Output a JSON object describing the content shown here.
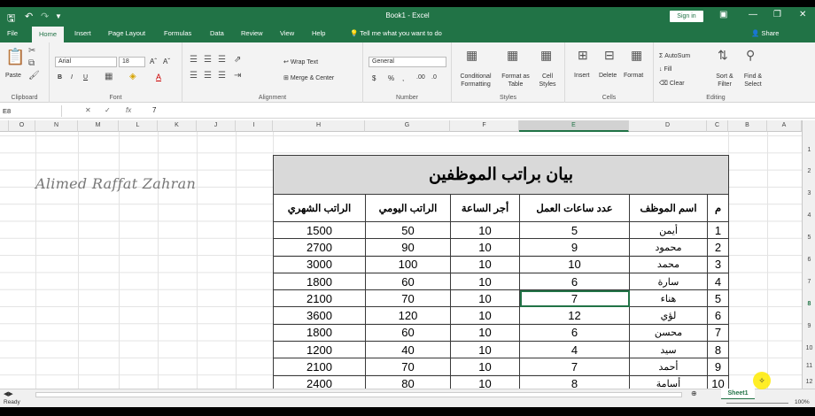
{
  "titlebar": {
    "title": "Book1 - Excel",
    "signin": "Sign in"
  },
  "tabs": [
    "File",
    "Home",
    "Insert",
    "Page Layout",
    "Formulas",
    "Data",
    "Review",
    "View",
    "Help"
  ],
  "active_tab": "Home",
  "tellme": "Tell me what you want to do",
  "share": "Share",
  "ribbon": {
    "font_name": "Arial",
    "font_size": "18",
    "wrap_text": "Wrap Text",
    "merge_center": "Merge & Center",
    "number_format": "General",
    "conditional_formatting": "Conditional Formatting",
    "format_as_table": "Format as Table",
    "cell_styles": "Cell Styles",
    "insert": "Insert",
    "delete": "Delete",
    "format": "Format",
    "autosum": "AutoSum",
    "fill": "Fill",
    "clear": "Clear",
    "sort_filter": "Sort & Filter",
    "find_select": "Find & Select",
    "paste": "Paste",
    "groups": {
      "clipboard": "Clipboard",
      "font": "Font",
      "alignment": "Alignment",
      "number": "Number",
      "styles": "Styles",
      "cells": "Cells",
      "editing": "Editing"
    }
  },
  "formula_bar": {
    "name_box": "E8",
    "value": "7"
  },
  "columns": [
    "O",
    "N",
    "M",
    "L",
    "K",
    "J",
    "I",
    "H",
    "G",
    "F",
    "E",
    "D",
    "C",
    "B",
    "A"
  ],
  "selected_column": "E",
  "row_numbers": [
    "1",
    "2",
    "3",
    "4",
    "5",
    "6",
    "7",
    "8",
    "9",
    "10",
    "11",
    "12"
  ],
  "watermark": "Alimed Raffat Zahran",
  "table": {
    "title": "بيان براتب الموظفين",
    "headers": [
      "م",
      "اسم الموظف",
      "عدد ساعات العمل",
      "أجر الساعة",
      "الراتب اليومي",
      "الراتب الشهري"
    ],
    "rows": [
      [
        "1",
        "أيمن",
        "5",
        "10",
        "50",
        "1500"
      ],
      [
        "2",
        "محمود",
        "9",
        "10",
        "90",
        "2700"
      ],
      [
        "3",
        "محمد",
        "10",
        "10",
        "100",
        "3000"
      ],
      [
        "4",
        "سارة",
        "6",
        "10",
        "60",
        "1800"
      ],
      [
        "5",
        "هناء",
        "7",
        "10",
        "70",
        "2100"
      ],
      [
        "6",
        "لؤي",
        "12",
        "10",
        "120",
        "3600"
      ],
      [
        "7",
        "محسن",
        "6",
        "10",
        "60",
        "1800"
      ],
      [
        "8",
        "سيد",
        "4",
        "10",
        "40",
        "1200"
      ],
      [
        "9",
        "أحمد",
        "7",
        "10",
        "70",
        "2100"
      ],
      [
        "10",
        "أسامة",
        "8",
        "10",
        "80",
        "2400"
      ]
    ]
  },
  "sheet_tab": "Sheet1",
  "status": {
    "ready": "Ready",
    "zoom": "100%"
  },
  "colors": {
    "excel_green": "#217346",
    "title_fill": "#d9d9d9"
  }
}
